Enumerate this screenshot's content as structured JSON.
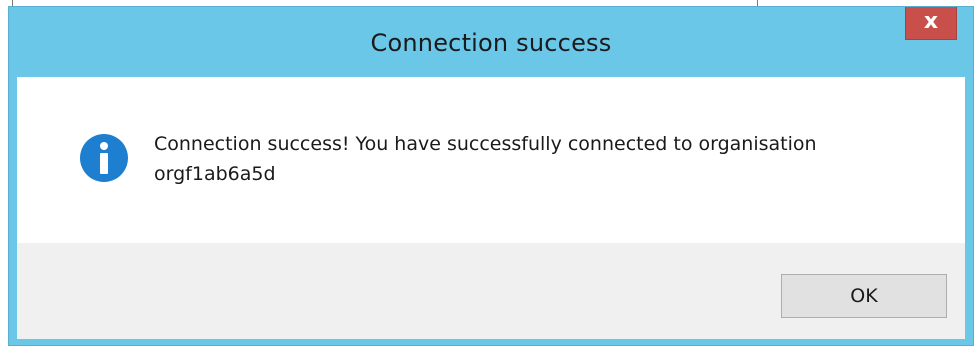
{
  "dialog": {
    "title": "Connection success",
    "close_label": "x",
    "icon": "info-icon",
    "message_line1": "Connection success! You have successfully connected to organisation",
    "message_line2": "orgf1ab6a5d",
    "ok_label": "OK"
  },
  "colors": {
    "titlebar": "#6bc7e8",
    "close_button": "#c9504a",
    "info_icon": "#1e7fd0",
    "footer": "#f0f0f0"
  }
}
